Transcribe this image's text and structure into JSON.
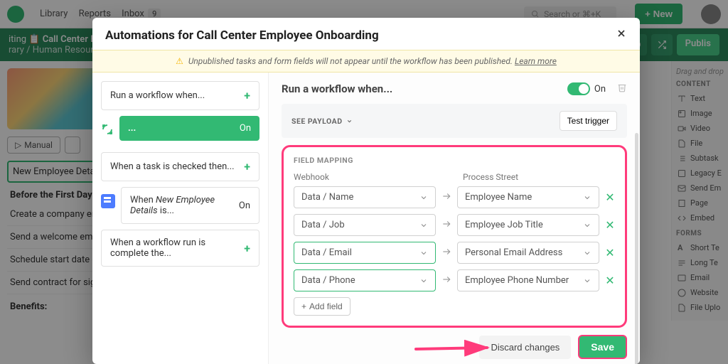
{
  "topbar": {
    "nav": [
      "Library",
      "Reports",
      "Inbox"
    ],
    "inbox_count": "9",
    "search_placeholder": "Search or ⌘+K",
    "new_label": "+  New"
  },
  "subheader": {
    "editing": "iting",
    "title": "Call Center Emp",
    "crumb1": "rary",
    "crumb2": "Human Resource",
    "publish": "Publis"
  },
  "bg": {
    "manual": "Manual",
    "drag_hint": "Drag and drop",
    "section_content": "CONTENT",
    "section_forms": "FORMS",
    "right_items_content": [
      "Text",
      "Image",
      "Video",
      "File",
      "Subtask",
      "Legacy E",
      "Send Em",
      "Page",
      "Embed"
    ],
    "right_items_forms": [
      "Short Te",
      "Long Te",
      "Email",
      "Website",
      "File Uplo"
    ],
    "tasks": {
      "active": "New Employee Detai",
      "heading1": "Before the First Day",
      "t1": "Create a company em",
      "t2": "Send a welcome ema",
      "t3": "Schedule start date e",
      "t4": "Send contract for sig",
      "heading2": "Benefits:"
    }
  },
  "modal": {
    "title": "Automations for Call Center Employee Onboarding",
    "warning_pre": "Unpublished tasks and form fields will not appear until the workflow has been published. ",
    "warning_link": "Learn more",
    "sidebar": {
      "run_when": "Run a workflow when...",
      "active_on": "On",
      "active_ellipsis": "...",
      "task_checked": "When a task is checked then...",
      "emp_details_pre": "When ",
      "emp_details_em": "New Employee Details",
      "emp_details_post": " is...",
      "emp_details_on": "On",
      "run_complete": "When a workflow run is complete the..."
    },
    "main": {
      "title": "Run a workflow when...",
      "on_label": "On",
      "see_payload": "SEE PAYLOAD",
      "test_trigger": "Test trigger",
      "field_mapping": "FIELD MAPPING",
      "col_webhook": "Webhook",
      "col_ps": "Process Street",
      "rows": [
        {
          "src": "Data / Name",
          "dst": "Employee Name",
          "green": false
        },
        {
          "src": "Data / Job",
          "dst": "Employee Job Title",
          "green": false
        },
        {
          "src": "Data / Email",
          "dst": "Personal Email Address",
          "green": true
        },
        {
          "src": "Data / Phone",
          "dst": "Employee Phone Number",
          "green": true
        }
      ],
      "add_field": "Add field",
      "discard": "Discard changes",
      "save": "Save"
    }
  }
}
